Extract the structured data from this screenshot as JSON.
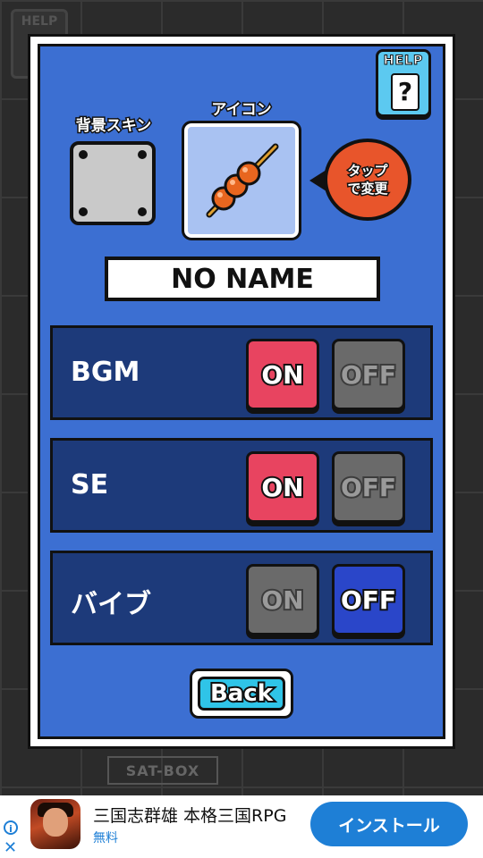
{
  "background": {
    "corner_label": "HELP",
    "box_label": "SAT-BOX"
  },
  "help_button": {
    "label": "HELP",
    "symbol": "?"
  },
  "skin": {
    "label": "背景スキン"
  },
  "icon": {
    "label": "アイコン",
    "image": "dango-skewer-icon"
  },
  "tap_hint": {
    "line1": "タップ",
    "line2": "で変更"
  },
  "player_name": "NO NAME",
  "settings": [
    {
      "label": "BGM",
      "on_label": "ON",
      "off_label": "OFF",
      "state": "on"
    },
    {
      "label": "SE",
      "on_label": "ON",
      "off_label": "OFF",
      "state": "on"
    },
    {
      "label": "バイブ",
      "on_label": "ON",
      "off_label": "OFF",
      "state": "off"
    }
  ],
  "back_button": {
    "label": "Back"
  },
  "ad": {
    "info_symbol": "i",
    "close_symbol": "✕",
    "title": "三国志群雄 本格三国RPG",
    "subtitle": "無料",
    "install_label": "インストール"
  },
  "colors": {
    "panel_blue": "#3c6fd2",
    "row_navy": "#1d3a7a",
    "on_red": "#e84460",
    "off_blue": "#2a46c9",
    "inactive_gray": "#6a6a6a",
    "install_blue": "#1e7fd6"
  }
}
